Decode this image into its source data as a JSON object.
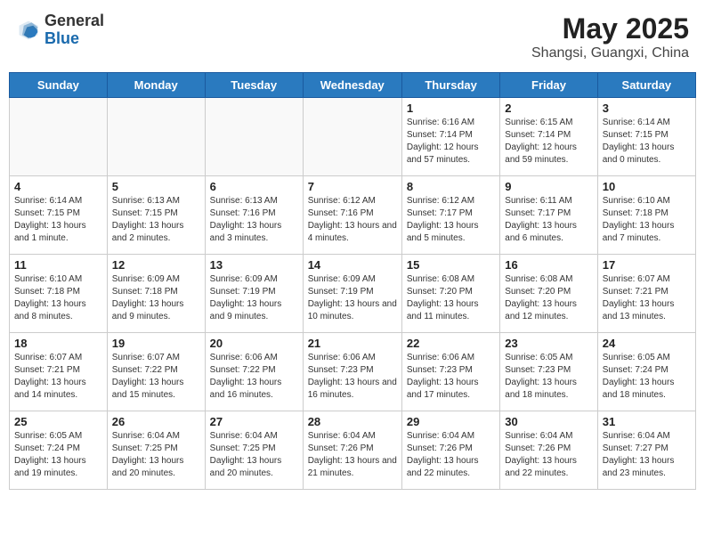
{
  "header": {
    "logo_general": "General",
    "logo_blue": "Blue",
    "month_title": "May 2025",
    "location": "Shangsi, Guangxi, China"
  },
  "weekdays": [
    "Sunday",
    "Monday",
    "Tuesday",
    "Wednesday",
    "Thursday",
    "Friday",
    "Saturday"
  ],
  "weeks": [
    [
      {
        "day": "",
        "info": ""
      },
      {
        "day": "",
        "info": ""
      },
      {
        "day": "",
        "info": ""
      },
      {
        "day": "",
        "info": ""
      },
      {
        "day": "1",
        "info": "Sunrise: 6:16 AM\nSunset: 7:14 PM\nDaylight: 12 hours\nand 57 minutes."
      },
      {
        "day": "2",
        "info": "Sunrise: 6:15 AM\nSunset: 7:14 PM\nDaylight: 12 hours\nand 59 minutes."
      },
      {
        "day": "3",
        "info": "Sunrise: 6:14 AM\nSunset: 7:15 PM\nDaylight: 13 hours\nand 0 minutes."
      }
    ],
    [
      {
        "day": "4",
        "info": "Sunrise: 6:14 AM\nSunset: 7:15 PM\nDaylight: 13 hours\nand 1 minute."
      },
      {
        "day": "5",
        "info": "Sunrise: 6:13 AM\nSunset: 7:15 PM\nDaylight: 13 hours\nand 2 minutes."
      },
      {
        "day": "6",
        "info": "Sunrise: 6:13 AM\nSunset: 7:16 PM\nDaylight: 13 hours\nand 3 minutes."
      },
      {
        "day": "7",
        "info": "Sunrise: 6:12 AM\nSunset: 7:16 PM\nDaylight: 13 hours\nand 4 minutes."
      },
      {
        "day": "8",
        "info": "Sunrise: 6:12 AM\nSunset: 7:17 PM\nDaylight: 13 hours\nand 5 minutes."
      },
      {
        "day": "9",
        "info": "Sunrise: 6:11 AM\nSunset: 7:17 PM\nDaylight: 13 hours\nand 6 minutes."
      },
      {
        "day": "10",
        "info": "Sunrise: 6:10 AM\nSunset: 7:18 PM\nDaylight: 13 hours\nand 7 minutes."
      }
    ],
    [
      {
        "day": "11",
        "info": "Sunrise: 6:10 AM\nSunset: 7:18 PM\nDaylight: 13 hours\nand 8 minutes."
      },
      {
        "day": "12",
        "info": "Sunrise: 6:09 AM\nSunset: 7:18 PM\nDaylight: 13 hours\nand 9 minutes."
      },
      {
        "day": "13",
        "info": "Sunrise: 6:09 AM\nSunset: 7:19 PM\nDaylight: 13 hours\nand 9 minutes."
      },
      {
        "day": "14",
        "info": "Sunrise: 6:09 AM\nSunset: 7:19 PM\nDaylight: 13 hours\nand 10 minutes."
      },
      {
        "day": "15",
        "info": "Sunrise: 6:08 AM\nSunset: 7:20 PM\nDaylight: 13 hours\nand 11 minutes."
      },
      {
        "day": "16",
        "info": "Sunrise: 6:08 AM\nSunset: 7:20 PM\nDaylight: 13 hours\nand 12 minutes."
      },
      {
        "day": "17",
        "info": "Sunrise: 6:07 AM\nSunset: 7:21 PM\nDaylight: 13 hours\nand 13 minutes."
      }
    ],
    [
      {
        "day": "18",
        "info": "Sunrise: 6:07 AM\nSunset: 7:21 PM\nDaylight: 13 hours\nand 14 minutes."
      },
      {
        "day": "19",
        "info": "Sunrise: 6:07 AM\nSunset: 7:22 PM\nDaylight: 13 hours\nand 15 minutes."
      },
      {
        "day": "20",
        "info": "Sunrise: 6:06 AM\nSunset: 7:22 PM\nDaylight: 13 hours\nand 16 minutes."
      },
      {
        "day": "21",
        "info": "Sunrise: 6:06 AM\nSunset: 7:23 PM\nDaylight: 13 hours\nand 16 minutes."
      },
      {
        "day": "22",
        "info": "Sunrise: 6:06 AM\nSunset: 7:23 PM\nDaylight: 13 hours\nand 17 minutes."
      },
      {
        "day": "23",
        "info": "Sunrise: 6:05 AM\nSunset: 7:23 PM\nDaylight: 13 hours\nand 18 minutes."
      },
      {
        "day": "24",
        "info": "Sunrise: 6:05 AM\nSunset: 7:24 PM\nDaylight: 13 hours\nand 18 minutes."
      }
    ],
    [
      {
        "day": "25",
        "info": "Sunrise: 6:05 AM\nSunset: 7:24 PM\nDaylight: 13 hours\nand 19 minutes."
      },
      {
        "day": "26",
        "info": "Sunrise: 6:04 AM\nSunset: 7:25 PM\nDaylight: 13 hours\nand 20 minutes."
      },
      {
        "day": "27",
        "info": "Sunrise: 6:04 AM\nSunset: 7:25 PM\nDaylight: 13 hours\nand 20 minutes."
      },
      {
        "day": "28",
        "info": "Sunrise: 6:04 AM\nSunset: 7:26 PM\nDaylight: 13 hours\nand 21 minutes."
      },
      {
        "day": "29",
        "info": "Sunrise: 6:04 AM\nSunset: 7:26 PM\nDaylight: 13 hours\nand 22 minutes."
      },
      {
        "day": "30",
        "info": "Sunrise: 6:04 AM\nSunset: 7:26 PM\nDaylight: 13 hours\nand 22 minutes."
      },
      {
        "day": "31",
        "info": "Sunrise: 6:04 AM\nSunset: 7:27 PM\nDaylight: 13 hours\nand 23 minutes."
      }
    ]
  ]
}
